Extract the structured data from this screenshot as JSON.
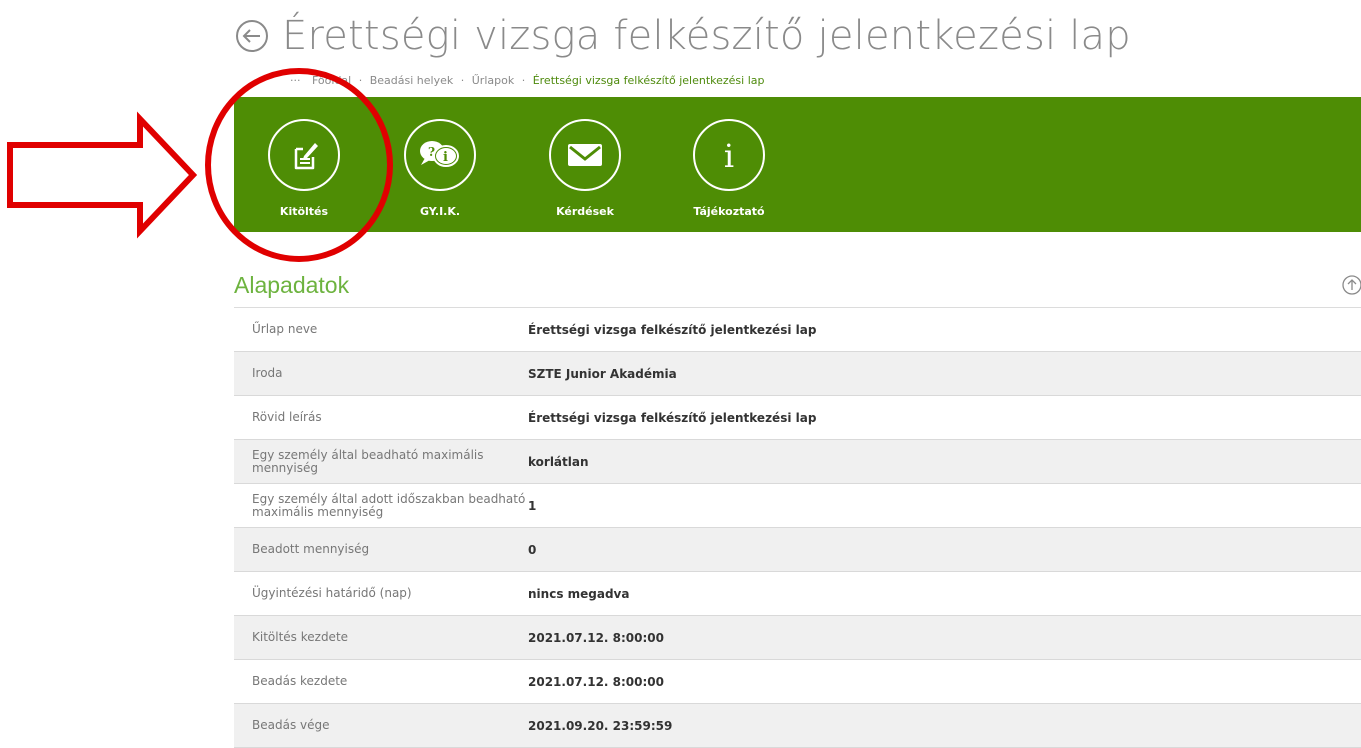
{
  "page": {
    "title": "Érettségi vizsga felkészítő jelentkezési lap"
  },
  "breadcrumb": {
    "ellipsis": "···",
    "items": [
      "Főoldal",
      "Beadási helyek",
      "Űrlapok"
    ],
    "current": "Érettségi vizsga felkészítő jelentkezési lap"
  },
  "toolbar": {
    "items": [
      {
        "label": "Kitöltés",
        "icon": "edit-form-icon"
      },
      {
        "label": "GY.I.K.",
        "icon": "faq-bubbles-icon"
      },
      {
        "label": "Kérdések",
        "icon": "envelope-icon"
      },
      {
        "label": "Tájékoztató",
        "icon": "info-icon"
      }
    ]
  },
  "section": {
    "title": "Alapadatok",
    "rows": [
      {
        "label": "Űrlap neve",
        "value": "Érettségi vizsga felkészítő jelentkezési lap"
      },
      {
        "label": "Iroda",
        "value": "SZTE Junior Akadémia"
      },
      {
        "label": "Rövid leírás",
        "value": "Érettségi vizsga felkészítő jelentkezési lap"
      },
      {
        "label": "Egy személy által beadható maximális mennyiség",
        "value": "korlátlan"
      },
      {
        "label": "Egy személy által adott időszakban beadható maximális mennyiség",
        "value": "1"
      },
      {
        "label": "Beadott mennyiség",
        "value": "0"
      },
      {
        "label": "Ügyintézési határidő (nap)",
        "value": "nincs megadva"
      },
      {
        "label": "Kitöltés kezdete",
        "value": "2021.07.12. 8:00:00"
      },
      {
        "label": "Beadás kezdete",
        "value": "2021.07.12. 8:00:00"
      },
      {
        "label": "Beadás vége",
        "value": "2021.09.20. 23:59:59"
      }
    ]
  },
  "colors": {
    "toolbar_bg": "#4e8d05",
    "section_title": "#6db33f",
    "annotation_red": "#e00000"
  }
}
